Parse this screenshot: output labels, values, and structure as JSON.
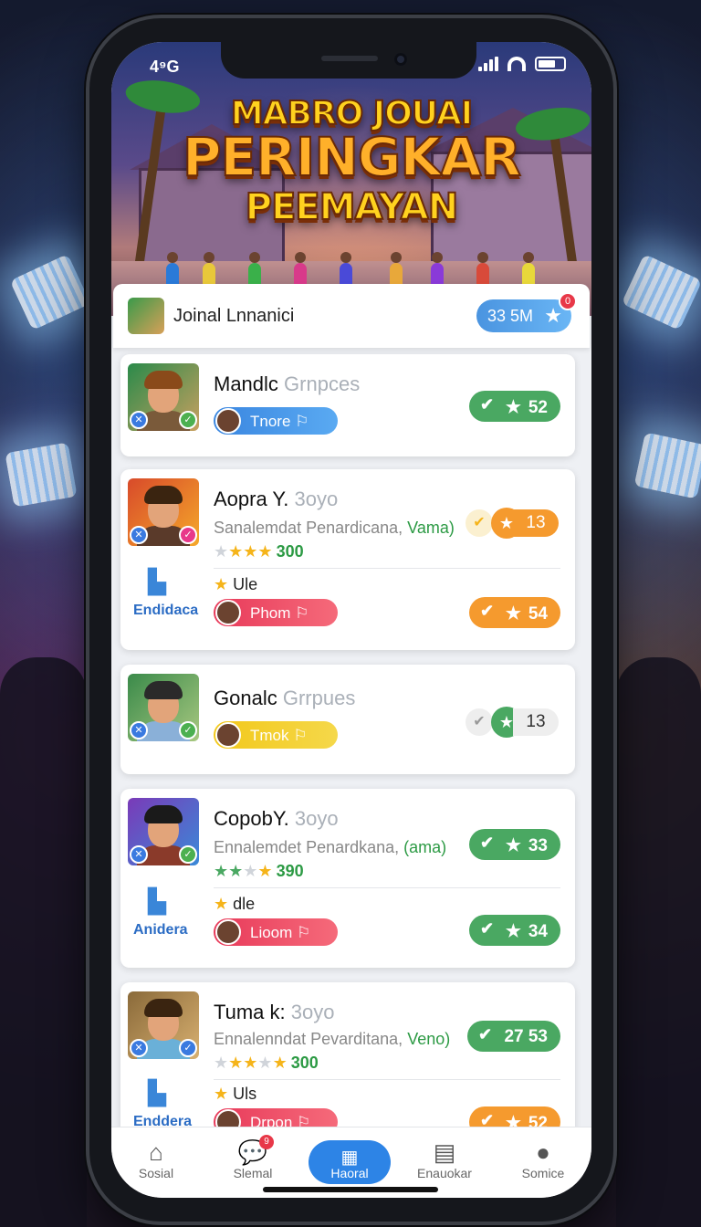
{
  "status": {
    "time": "4⁹G"
  },
  "hero": {
    "line1": "MABRO JOUAI",
    "line2": "PERINGKAR",
    "line3": "PEEMAYAN"
  },
  "top": {
    "name": "Joinal Lnnanici",
    "score": "33 5M",
    "star": "★",
    "badge": "0"
  },
  "cards": [
    {
      "name": "Mandlc",
      "name_faint": "Grnpces",
      "tag": "Tnore",
      "tag_symbol": "⚐",
      "score": "52",
      "score_color": "green"
    },
    {
      "name": "Aopra Y.",
      "name_faint": "3oyo",
      "sub": "Sanalemdat Penardicana,",
      "sub_green": "Vama)",
      "stars_num": "300",
      "rank_num": "13",
      "side_label": "Endidaca",
      "sub_star_label": "Ule",
      "tag": "Phom",
      "tag_symbol": "⚐",
      "score": "54",
      "score_color": "orange"
    },
    {
      "name": "Gonalc",
      "name_faint": "Grrpues",
      "tag": "Tmok",
      "tag_symbol": "⚐",
      "rank_num": "13"
    },
    {
      "name": "CopobY.",
      "name_faint": "3oyo",
      "sub": "Ennalemdet Penardkana,",
      "sub_green": "(ama)",
      "stars_num": "390",
      "score": "33",
      "score_color": "green",
      "side_label": "Anidera",
      "sub_star_label": "dle",
      "tag": "Lioom",
      "tag_symbol": "⚐",
      "score2": "34",
      "score2_color": "green"
    },
    {
      "name": "Tuma k:",
      "name_faint": "3oyo",
      "sub": "Ennalenndat Pevarditana,",
      "sub_green": "Veno)",
      "stars_num": "300",
      "score": "27 53",
      "score_color": "green",
      "side_label": "Enddera",
      "sub_star_label": "Uls",
      "tag": "Drpon",
      "tag_symbol": "⚐",
      "score2": "52",
      "score2_color": "orange"
    }
  ],
  "tabs": [
    {
      "label": "Sosial",
      "icon": "home-icon"
    },
    {
      "label": "Slemal",
      "icon": "chat-icon",
      "badge": "9"
    },
    {
      "label": "Haoral",
      "icon": "grid-icon",
      "active": true
    },
    {
      "label": "Enauokar",
      "icon": "list-icon"
    },
    {
      "label": "Somice",
      "icon": "profile-icon"
    }
  ],
  "colors": {
    "accent": "#2d84e6",
    "green": "#4aa862",
    "orange": "#f59a2e",
    "title": "#ffd21f"
  }
}
